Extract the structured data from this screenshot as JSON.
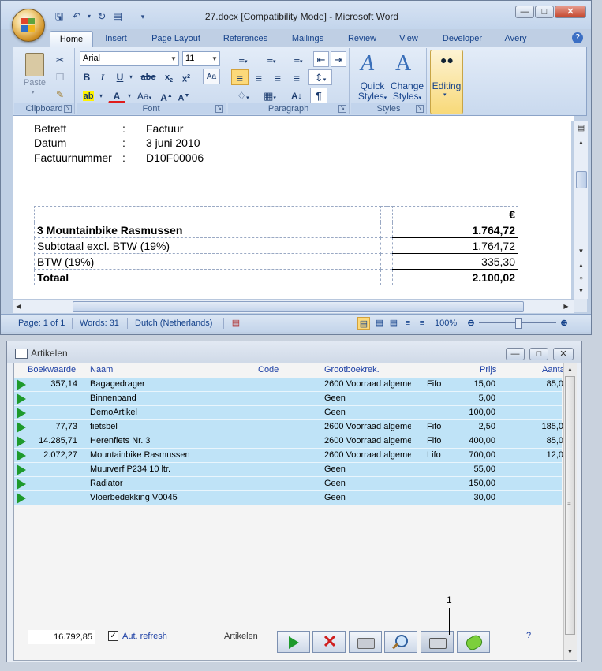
{
  "word": {
    "title": "27.docx [Compatibility Mode] - Microsoft Word",
    "tabs": [
      "Home",
      "Insert",
      "Page Layout",
      "References",
      "Mailings",
      "Review",
      "View",
      "Developer",
      "Avery"
    ],
    "groups": {
      "clipboard": {
        "label": "Clipboard",
        "paste": "Paste"
      },
      "font": {
        "label": "Font",
        "font_name": "Arial",
        "font_size": "11"
      },
      "paragraph": {
        "label": "Paragraph"
      },
      "styles": {
        "label": "Styles",
        "quick_styles": "Quick",
        "quick_styles2": "Styles",
        "change_styles": "Change",
        "change_styles2": "Styles"
      },
      "editing": {
        "label": "Editing"
      }
    },
    "document": {
      "fields": [
        {
          "label": "Betreft",
          "sep": ":",
          "value": "Factuur"
        },
        {
          "label": "Datum",
          "sep": ":",
          "value": "3 juni 2010"
        },
        {
          "label": "Factuurnummer",
          "sep": ":",
          "value": "D10F00006"
        }
      ],
      "currency": "€",
      "rows": [
        {
          "label": "3 Mountainbike Rasmussen",
          "amount": "1.764,72"
        },
        {
          "label": "Subtotaal excl. BTW (19%)",
          "amount": "1.764,72"
        },
        {
          "label": "BTW (19%)",
          "amount": "335,30"
        },
        {
          "label": "Totaal",
          "amount": "2.100,02"
        }
      ]
    },
    "status": {
      "page": "Page: 1 of 1",
      "words": "Words: 31",
      "language": "Dutch (Netherlands)",
      "zoom": "100%",
      "zoom_level": 0.5
    }
  },
  "artikelen": {
    "title": "Artikelen",
    "columns": [
      "Boekwaarde",
      "Naam",
      "Code",
      "Grootboekrek.",
      "Prijs",
      "Aanta"
    ],
    "rows": [
      {
        "boekwaarde": "357,14",
        "naam": "Bagagedrager",
        "code": "",
        "grootboek": "2600 Voorraad algeme",
        "methode": "Fifo",
        "prijs": "15,00",
        "aantal": "85,0"
      },
      {
        "boekwaarde": "",
        "naam": "Binnenband",
        "code": "",
        "grootboek": "Geen",
        "methode": "",
        "prijs": "5,00",
        "aantal": ""
      },
      {
        "boekwaarde": "",
        "naam": "DemoArtikel",
        "code": "",
        "grootboek": "Geen",
        "methode": "",
        "prijs": "100,00",
        "aantal": ""
      },
      {
        "boekwaarde": "77,73",
        "naam": "fietsbel",
        "code": "",
        "grootboek": "2600 Voorraad algeme",
        "methode": "Fifo",
        "prijs": "2,50",
        "aantal": "185,0"
      },
      {
        "boekwaarde": "14.285,71",
        "naam": "Herenfiets Nr. 3",
        "code": "",
        "grootboek": "2600 Voorraad algeme",
        "methode": "Fifo",
        "prijs": "400,00",
        "aantal": "85,0"
      },
      {
        "boekwaarde": "2.072,27",
        "naam": "Mountainbike Rasmussen",
        "code": "",
        "grootboek": "2600 Voorraad algeme",
        "methode": "Lifo",
        "prijs": "700,00",
        "aantal": "12,0"
      },
      {
        "boekwaarde": "",
        "naam": "Muurverf P234 10 ltr.",
        "code": "",
        "grootboek": "Geen",
        "methode": "",
        "prijs": "55,00",
        "aantal": ""
      },
      {
        "boekwaarde": "",
        "naam": "Radiator",
        "code": "",
        "grootboek": "Geen",
        "methode": "",
        "prijs": "150,00",
        "aantal": ""
      },
      {
        "boekwaarde": "",
        "naam": "Vloerbedekking V0045",
        "code": "",
        "grootboek": "Geen",
        "methode": "",
        "prijs": "30,00",
        "aantal": ""
      }
    ],
    "total": "16.792,85",
    "auto_refresh": "Aut. refresh",
    "toolbar_label": "Artikelen",
    "help": "?",
    "annotation": "1"
  }
}
